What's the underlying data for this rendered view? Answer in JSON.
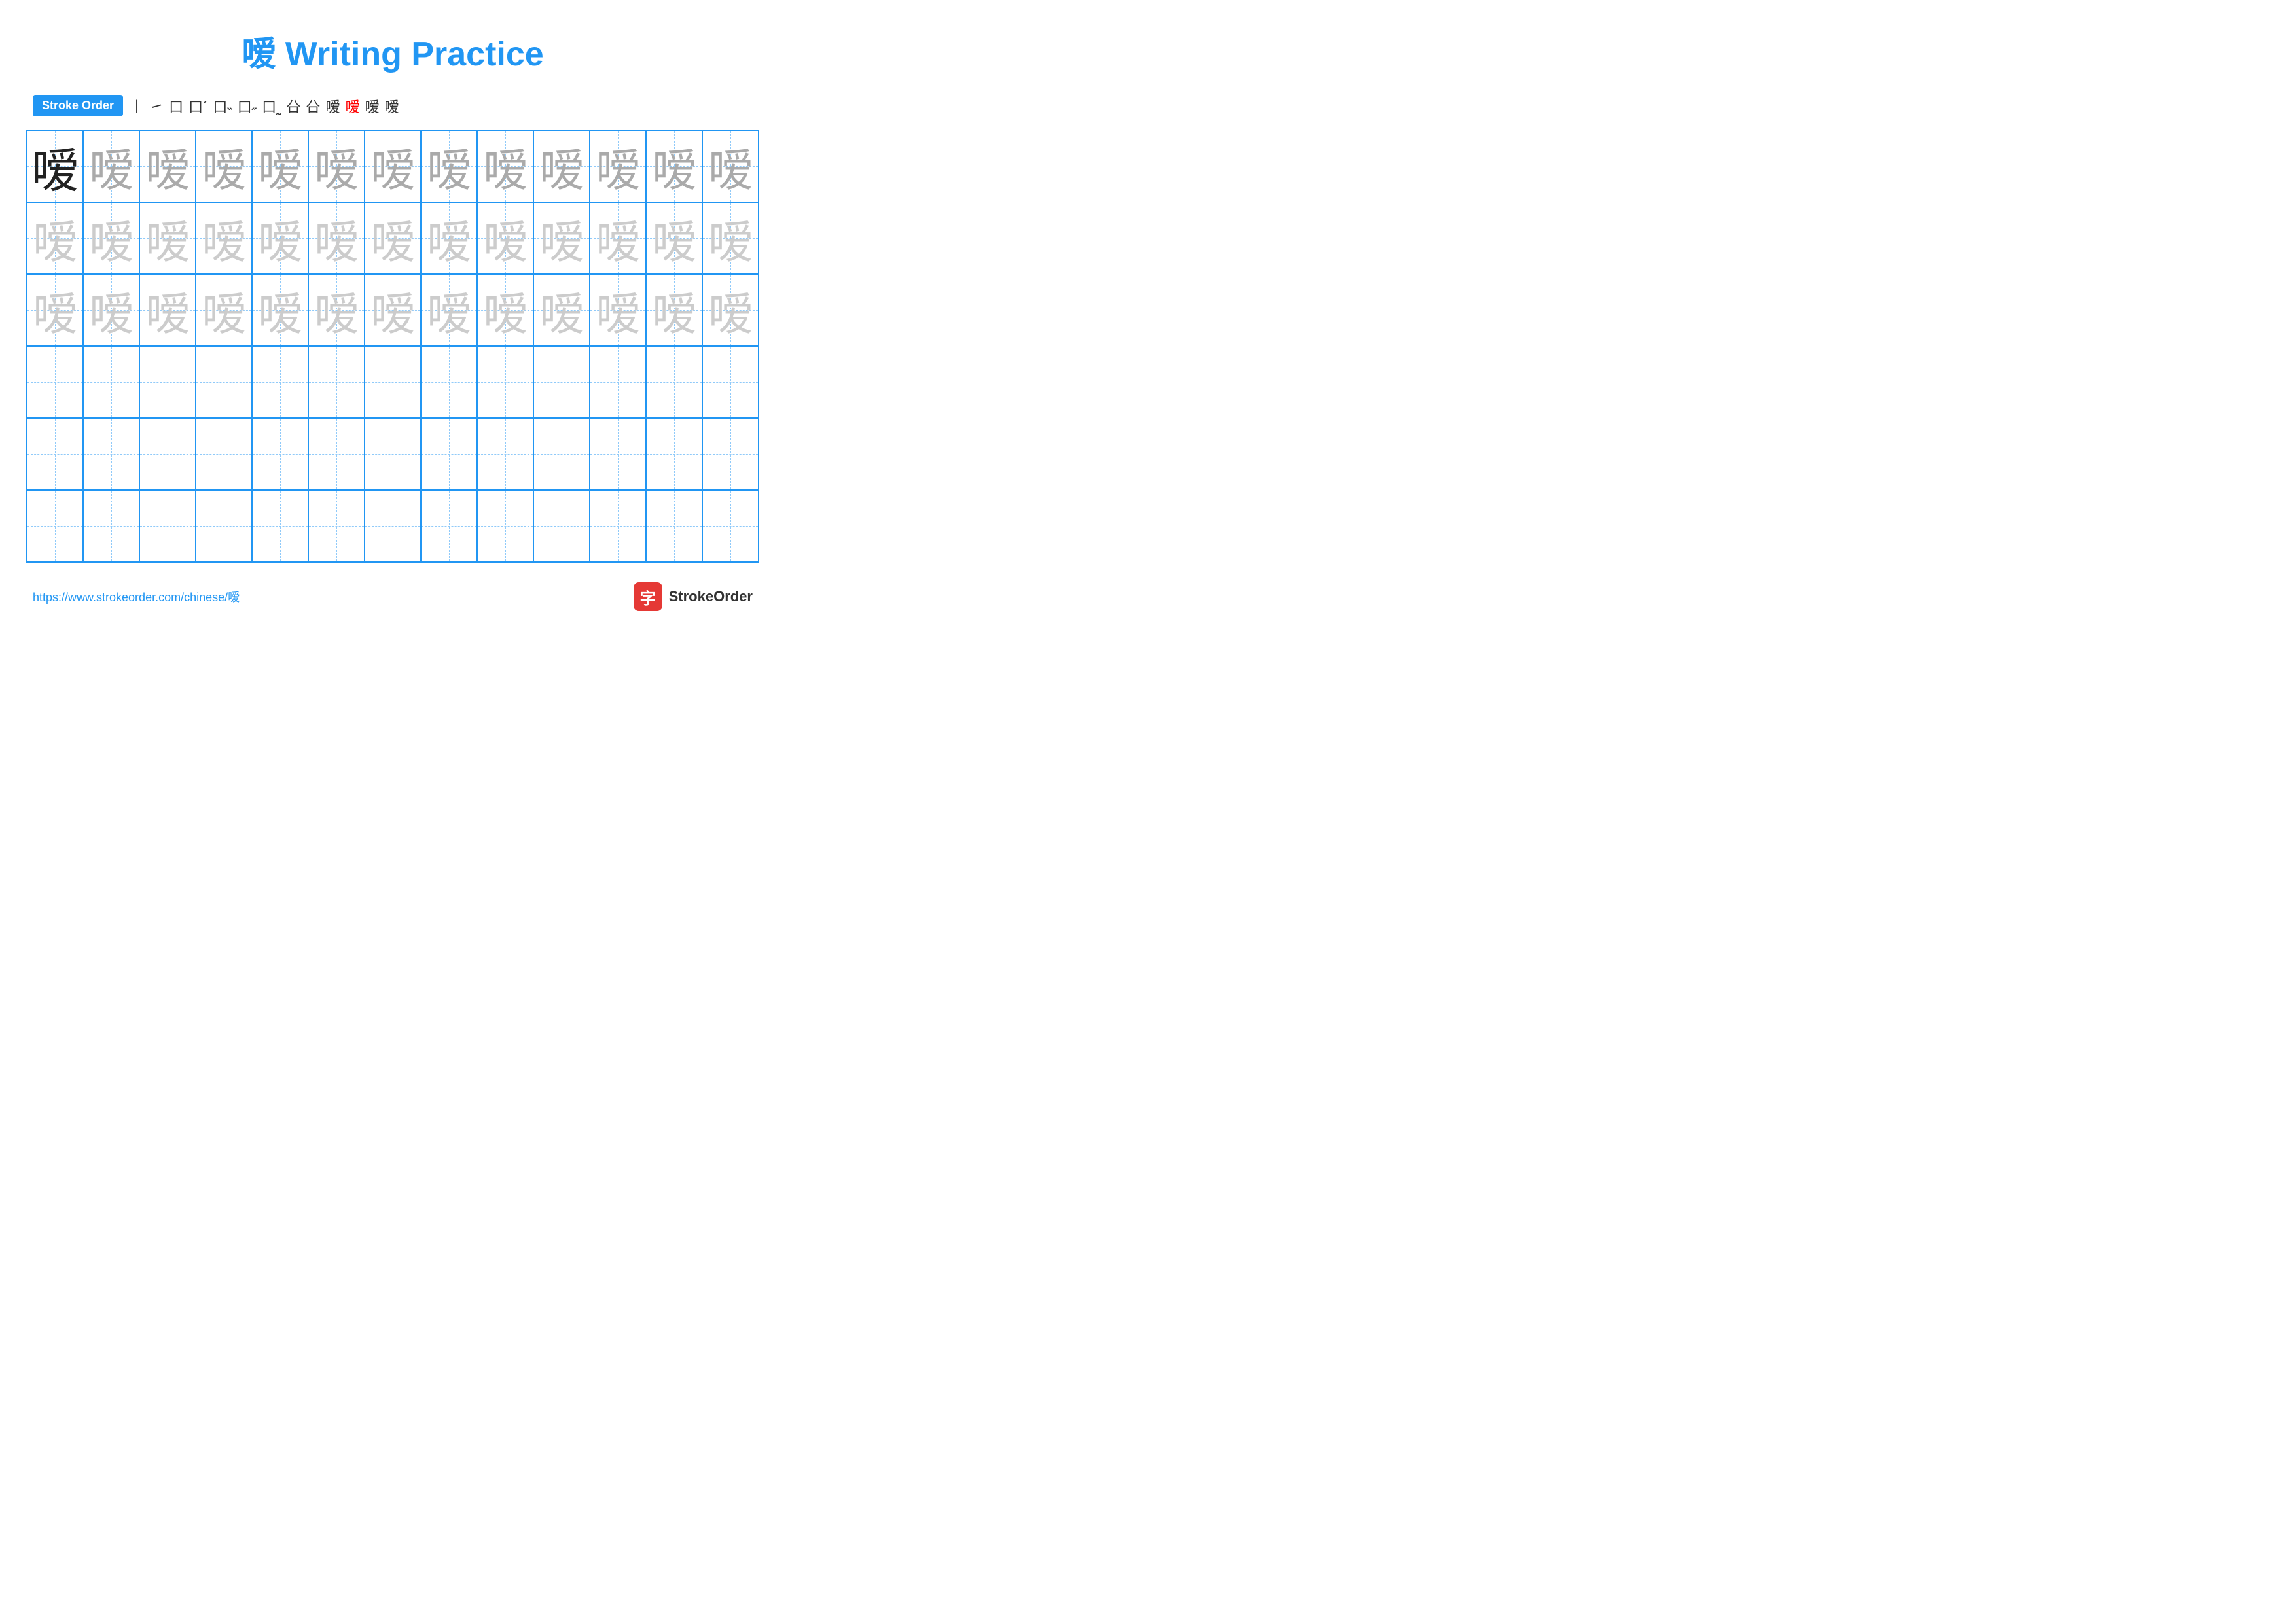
{
  "title": "嗳 Writing Practice",
  "strokeOrder": {
    "label": "Stroke Order",
    "sequence": [
      "⼁",
      "㇀",
      "口",
      "口˴",
      "口˵",
      "口˶",
      "口˷",
      "㕣",
      "㖩",
      "嗳",
      "嗳",
      "嗳",
      "嗳"
    ]
  },
  "character": "嗳",
  "grid": {
    "rows": 6,
    "cols": 13
  },
  "footer": {
    "url": "https://www.strokeorder.com/chinese/嗳",
    "logoText": "StrokeOrder",
    "logoChar": "字"
  }
}
